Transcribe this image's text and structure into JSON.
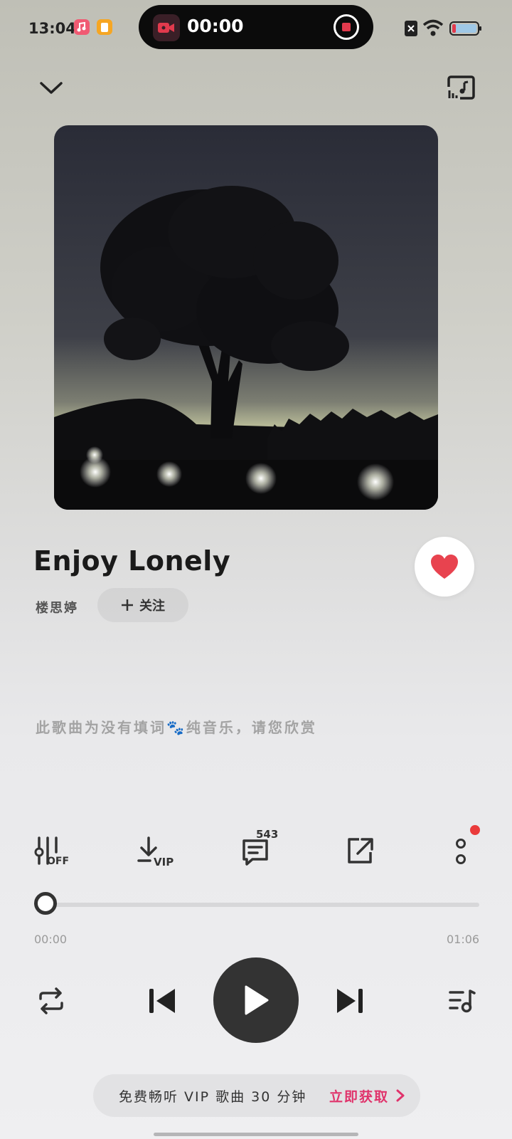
{
  "status_bar": {
    "time": "13:04",
    "recording_time": "00:00"
  },
  "song": {
    "title": "Enjoy Lonely",
    "artist": "楼思婷",
    "follow_label": "关注",
    "liked": true
  },
  "lyrics": {
    "note": "此歌曲为没有填词🐾纯音乐，请您欣赏"
  },
  "actions": {
    "equalizer_label": "OFF",
    "download_label": "VIP",
    "comment_count": "543"
  },
  "progress": {
    "current": "00:00",
    "total": "01:06",
    "fraction": 0.0
  },
  "vip_banner": {
    "text": "免费畅听 VIP 歌曲 30 分钟",
    "cta": "立即获取"
  },
  "colors": {
    "like_red": "#e8434f",
    "cta_pink": "#e0336b",
    "notification_dot": "#ea3b3b"
  },
  "icons": [
    "chevron-down-icon",
    "cast-icon",
    "equalizer-icon",
    "download-icon",
    "comment-icon",
    "share-icon",
    "more-icon",
    "repeat-icon",
    "previous-icon",
    "play-icon",
    "next-icon",
    "playlist-icon",
    "heart-icon"
  ]
}
